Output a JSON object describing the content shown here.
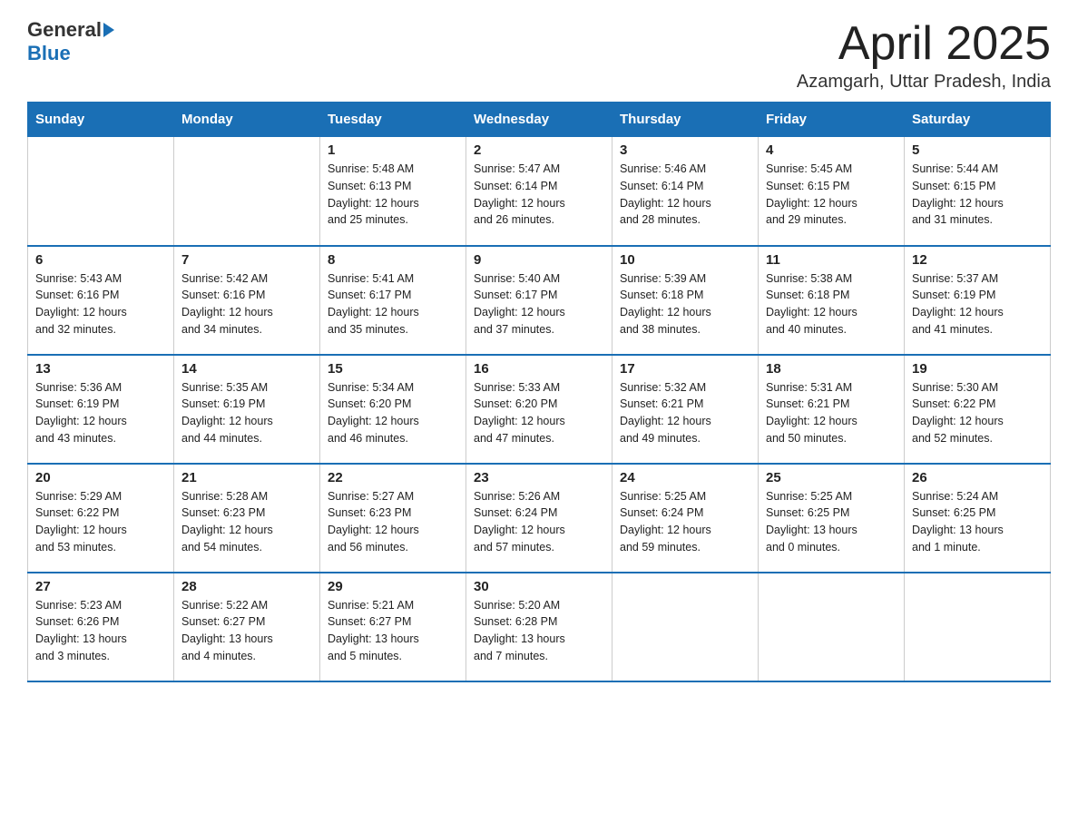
{
  "header": {
    "logo_text_general": "General",
    "logo_text_blue": "Blue",
    "month_title": "April 2025",
    "location": "Azamgarh, Uttar Pradesh, India"
  },
  "weekdays": [
    "Sunday",
    "Monday",
    "Tuesday",
    "Wednesday",
    "Thursday",
    "Friday",
    "Saturday"
  ],
  "weeks": [
    [
      {
        "day": "",
        "info": ""
      },
      {
        "day": "",
        "info": ""
      },
      {
        "day": "1",
        "info": "Sunrise: 5:48 AM\nSunset: 6:13 PM\nDaylight: 12 hours\nand 25 minutes."
      },
      {
        "day": "2",
        "info": "Sunrise: 5:47 AM\nSunset: 6:14 PM\nDaylight: 12 hours\nand 26 minutes."
      },
      {
        "day": "3",
        "info": "Sunrise: 5:46 AM\nSunset: 6:14 PM\nDaylight: 12 hours\nand 28 minutes."
      },
      {
        "day": "4",
        "info": "Sunrise: 5:45 AM\nSunset: 6:15 PM\nDaylight: 12 hours\nand 29 minutes."
      },
      {
        "day": "5",
        "info": "Sunrise: 5:44 AM\nSunset: 6:15 PM\nDaylight: 12 hours\nand 31 minutes."
      }
    ],
    [
      {
        "day": "6",
        "info": "Sunrise: 5:43 AM\nSunset: 6:16 PM\nDaylight: 12 hours\nand 32 minutes."
      },
      {
        "day": "7",
        "info": "Sunrise: 5:42 AM\nSunset: 6:16 PM\nDaylight: 12 hours\nand 34 minutes."
      },
      {
        "day": "8",
        "info": "Sunrise: 5:41 AM\nSunset: 6:17 PM\nDaylight: 12 hours\nand 35 minutes."
      },
      {
        "day": "9",
        "info": "Sunrise: 5:40 AM\nSunset: 6:17 PM\nDaylight: 12 hours\nand 37 minutes."
      },
      {
        "day": "10",
        "info": "Sunrise: 5:39 AM\nSunset: 6:18 PM\nDaylight: 12 hours\nand 38 minutes."
      },
      {
        "day": "11",
        "info": "Sunrise: 5:38 AM\nSunset: 6:18 PM\nDaylight: 12 hours\nand 40 minutes."
      },
      {
        "day": "12",
        "info": "Sunrise: 5:37 AM\nSunset: 6:19 PM\nDaylight: 12 hours\nand 41 minutes."
      }
    ],
    [
      {
        "day": "13",
        "info": "Sunrise: 5:36 AM\nSunset: 6:19 PM\nDaylight: 12 hours\nand 43 minutes."
      },
      {
        "day": "14",
        "info": "Sunrise: 5:35 AM\nSunset: 6:19 PM\nDaylight: 12 hours\nand 44 minutes."
      },
      {
        "day": "15",
        "info": "Sunrise: 5:34 AM\nSunset: 6:20 PM\nDaylight: 12 hours\nand 46 minutes."
      },
      {
        "day": "16",
        "info": "Sunrise: 5:33 AM\nSunset: 6:20 PM\nDaylight: 12 hours\nand 47 minutes."
      },
      {
        "day": "17",
        "info": "Sunrise: 5:32 AM\nSunset: 6:21 PM\nDaylight: 12 hours\nand 49 minutes."
      },
      {
        "day": "18",
        "info": "Sunrise: 5:31 AM\nSunset: 6:21 PM\nDaylight: 12 hours\nand 50 minutes."
      },
      {
        "day": "19",
        "info": "Sunrise: 5:30 AM\nSunset: 6:22 PM\nDaylight: 12 hours\nand 52 minutes."
      }
    ],
    [
      {
        "day": "20",
        "info": "Sunrise: 5:29 AM\nSunset: 6:22 PM\nDaylight: 12 hours\nand 53 minutes."
      },
      {
        "day": "21",
        "info": "Sunrise: 5:28 AM\nSunset: 6:23 PM\nDaylight: 12 hours\nand 54 minutes."
      },
      {
        "day": "22",
        "info": "Sunrise: 5:27 AM\nSunset: 6:23 PM\nDaylight: 12 hours\nand 56 minutes."
      },
      {
        "day": "23",
        "info": "Sunrise: 5:26 AM\nSunset: 6:24 PM\nDaylight: 12 hours\nand 57 minutes."
      },
      {
        "day": "24",
        "info": "Sunrise: 5:25 AM\nSunset: 6:24 PM\nDaylight: 12 hours\nand 59 minutes."
      },
      {
        "day": "25",
        "info": "Sunrise: 5:25 AM\nSunset: 6:25 PM\nDaylight: 13 hours\nand 0 minutes."
      },
      {
        "day": "26",
        "info": "Sunrise: 5:24 AM\nSunset: 6:25 PM\nDaylight: 13 hours\nand 1 minute."
      }
    ],
    [
      {
        "day": "27",
        "info": "Sunrise: 5:23 AM\nSunset: 6:26 PM\nDaylight: 13 hours\nand 3 minutes."
      },
      {
        "day": "28",
        "info": "Sunrise: 5:22 AM\nSunset: 6:27 PM\nDaylight: 13 hours\nand 4 minutes."
      },
      {
        "day": "29",
        "info": "Sunrise: 5:21 AM\nSunset: 6:27 PM\nDaylight: 13 hours\nand 5 minutes."
      },
      {
        "day": "30",
        "info": "Sunrise: 5:20 AM\nSunset: 6:28 PM\nDaylight: 13 hours\nand 7 minutes."
      },
      {
        "day": "",
        "info": ""
      },
      {
        "day": "",
        "info": ""
      },
      {
        "day": "",
        "info": ""
      }
    ]
  ]
}
